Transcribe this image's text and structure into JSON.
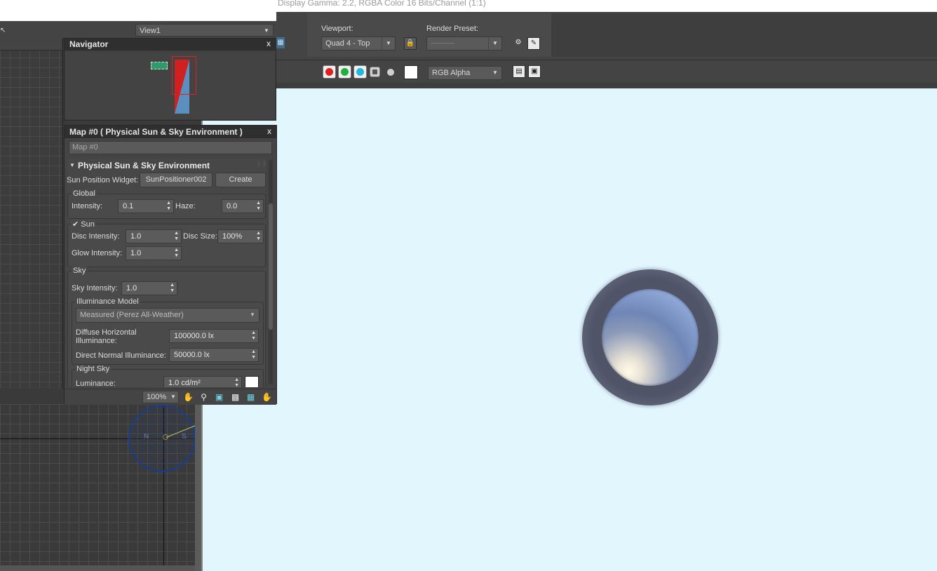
{
  "frame_window": {
    "title_text": "Display Gamma: 2.2, RGBA Color 16 Bits/Channel (1:1)",
    "viewport_label": "Viewport:",
    "viewport_value": "Quad 4 - Top",
    "render_preset_label": "Render Preset:",
    "render_preset_value": "--------------------",
    "channel_display": "RGB Alpha",
    "channels": [
      {
        "name": "red",
        "color": "#e02020"
      },
      {
        "name": "green",
        "color": "#20b040"
      },
      {
        "name": "blue",
        "color": "#20b8e0"
      }
    ],
    "canvas_color": "#e2f6fe"
  },
  "view_dropdown": "View1",
  "navigator": {
    "title": "Navigator",
    "close": "x"
  },
  "map_panel": {
    "title": "Map #0  ( Physical Sun & Sky Environment )",
    "close": "x",
    "map_name": "Map #0",
    "rollout_title": "Physical Sun & Sky Environment",
    "sun_position_label": "Sun Position Widget:",
    "sun_position_value": "SunPositioner002",
    "create_label": "Create",
    "global": {
      "label": "Global",
      "intensity_label": "Intensity:",
      "intensity_value": "0.1",
      "haze_label": "Haze:",
      "haze_value": "0.0"
    },
    "sun": {
      "label": "Sun",
      "checked": true,
      "disc_intensity_label": "Disc Intensity:",
      "disc_intensity_value": "1.0",
      "disc_size_label": "Disc Size:",
      "disc_size_value": "100%",
      "glow_intensity_label": "Glow Intensity:",
      "glow_intensity_value": "1.0"
    },
    "sky": {
      "label": "Sky",
      "sky_intensity_label": "Sky Intensity:",
      "sky_intensity_value": "1.0",
      "illuminance_model_label": "Illuminance Model",
      "illuminance_model_value": "Measured (Perez All-Weather)",
      "diffuse_label_1": "Diffuse Horizontal",
      "diffuse_label_2": "Illuminance:",
      "diffuse_value": "100000.0 lx",
      "direct_label": "Direct Normal Illuminance:",
      "direct_value": "50000.0 lx"
    },
    "night_sky": {
      "label": "Night Sky",
      "luminance_label": "Luminance:",
      "luminance_value": "1.0 cd/m²"
    },
    "zoom_value": "100%"
  },
  "compass": {
    "north": "N",
    "south": "S"
  }
}
